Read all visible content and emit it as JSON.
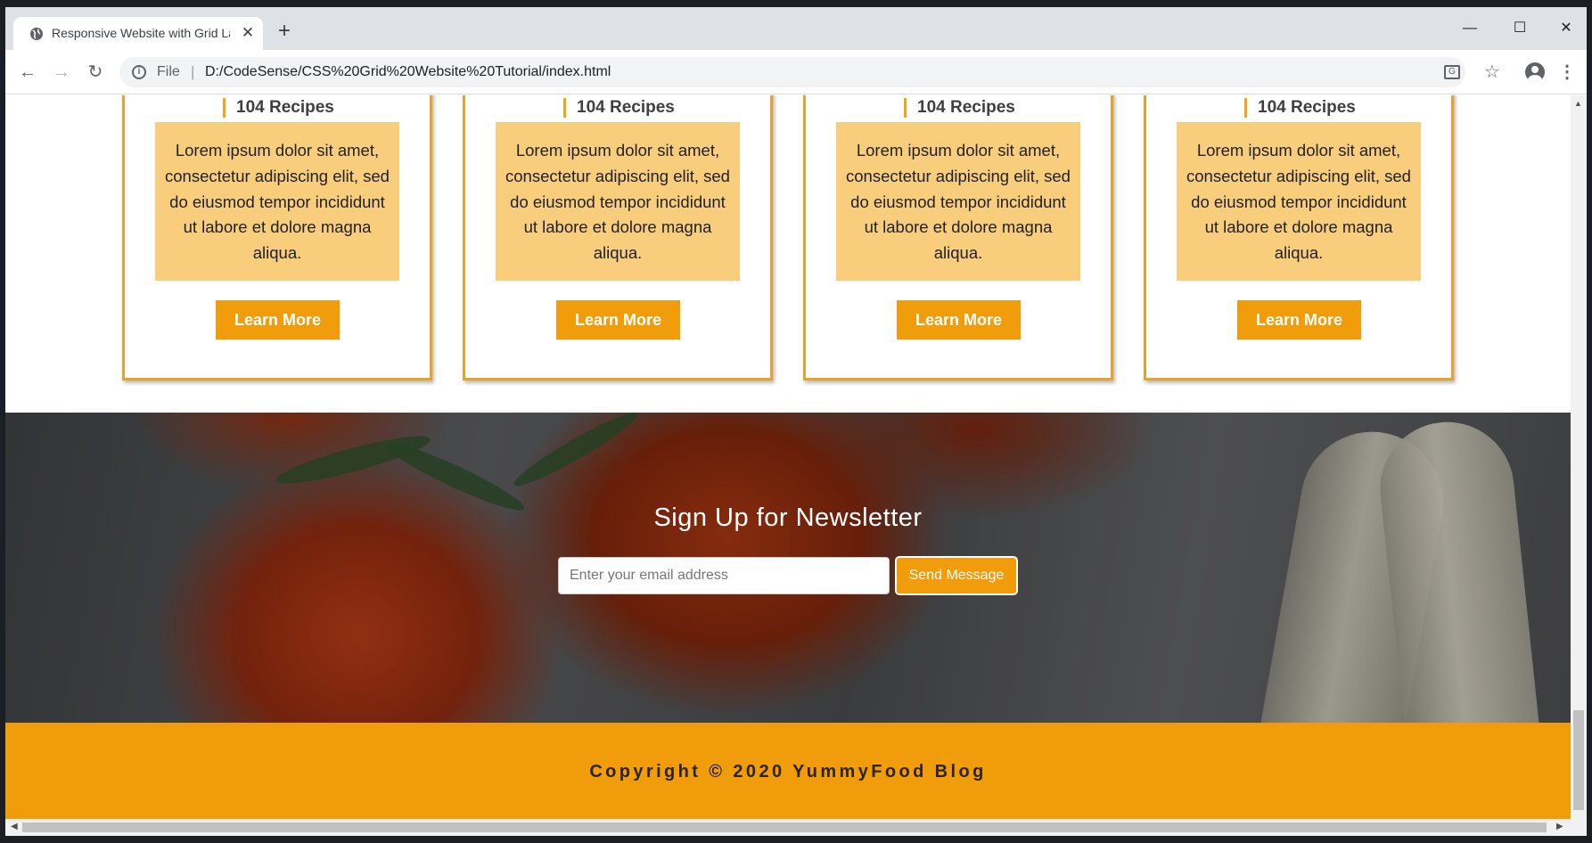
{
  "browser": {
    "tab_title": "Responsive Website with Grid La",
    "tab_close": "✕",
    "new_tab": "+",
    "url_scheme": "File",
    "url_separator": "|",
    "url": "D:/CodeSense/CSS%20Grid%20Website%20Tutorial/index.html",
    "back_icon": "←",
    "forward_icon": "→",
    "reload_icon": "↻",
    "star_icon": "☆",
    "menu_icon": "⋮",
    "info_icon": "i",
    "translate_icon": "G",
    "minimize_icon": "—",
    "maximize_icon": "☐",
    "close_icon": "✕"
  },
  "cards": [
    {
      "count": "104 Recipes",
      "description": "Lorem ipsum dolor sit amet, consectetur adipiscing elit, sed do eiusmod tempor incididunt ut labore et dolore magna aliqua.",
      "button": "Learn More"
    },
    {
      "count": "104 Recipes",
      "description": "Lorem ipsum dolor sit amet, consectetur adipiscing elit, sed do eiusmod tempor incididunt ut labore et dolore magna aliqua.",
      "button": "Learn More"
    },
    {
      "count": "104 Recipes",
      "description": "Lorem ipsum dolor sit amet, consectetur adipiscing elit, sed do eiusmod tempor incididunt ut labore et dolore magna aliqua.",
      "button": "Learn More"
    },
    {
      "count": "104 Recipes",
      "description": "Lorem ipsum dolor sit amet, consectetur adipiscing elit, sed do eiusmod tempor incididunt ut labore et dolore magna aliqua.",
      "button": "Learn More"
    }
  ],
  "newsletter": {
    "heading": "Sign Up for Newsletter",
    "email_placeholder": "Enter your email address",
    "button": "Send Message"
  },
  "footer": {
    "copyright": "Copyright © 2020 YummyFood Blog"
  },
  "colors": {
    "accent": "#f09c0b",
    "card_border": "#e6a32c",
    "card_text_bg": "#f8cd7b"
  }
}
